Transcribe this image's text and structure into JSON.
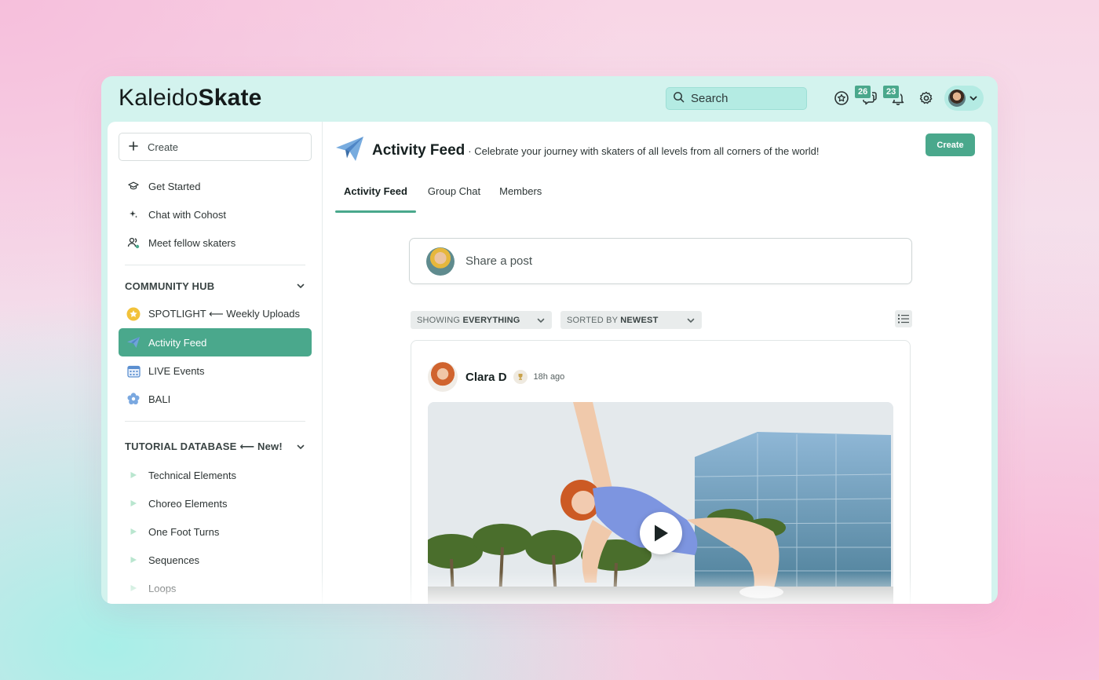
{
  "app": {
    "logo_light": "Kaleido",
    "logo_bold": "Skate"
  },
  "topbar": {
    "search_placeholder": "Search",
    "chat_badge": "26",
    "notifications_badge": "23"
  },
  "sidebar": {
    "create_label": "Create",
    "primary_items": [
      {
        "label": "Get Started",
        "icon": "graduation-cap-icon"
      },
      {
        "label": "Chat with Cohost",
        "icon": "sparkle-icon"
      },
      {
        "label": "Meet fellow skaters",
        "icon": "users-icon"
      }
    ],
    "community_hub": {
      "title": "COMMUNITY HUB",
      "items": [
        {
          "label": "SPOTLIGHT ⟵ Weekly Uploads",
          "icon": "star-icon"
        },
        {
          "label": "Activity Feed",
          "icon": "paper-plane-icon",
          "active": true
        },
        {
          "label": "LIVE Events",
          "icon": "calendar-icon"
        },
        {
          "label": "BALI",
          "icon": "flower-icon"
        }
      ]
    },
    "tutorial_database": {
      "title": "TUTORIAL DATABASE ⟵ New!",
      "items": [
        {
          "label": "Technical Elements",
          "icon": "play-triangle-icon"
        },
        {
          "label": "Choreo Elements",
          "icon": "play-triangle-icon"
        },
        {
          "label": "One Foot Turns",
          "icon": "play-triangle-icon"
        },
        {
          "label": "Sequences",
          "icon": "play-triangle-icon"
        },
        {
          "label": "Loops",
          "icon": "play-triangle-icon"
        }
      ]
    }
  },
  "main": {
    "title": "Activity Feed",
    "subtitle": "· Celebrate your journey with skaters of all levels from all corners of the world!",
    "create_label": "Create",
    "tabs": [
      {
        "label": "Activity Feed",
        "active": true
      },
      {
        "label": "Group Chat"
      },
      {
        "label": "Members"
      }
    ],
    "share_placeholder": "Share a post",
    "filter_showing_prefix": "SHOWING",
    "filter_showing_value": "EVERYTHING",
    "filter_sort_prefix": "SORTED BY",
    "filter_sort_value": "NEWEST",
    "post": {
      "author": "Clara D",
      "time": "18h ago"
    }
  },
  "colors": {
    "accent": "#4aa88c",
    "window_bg": "#d3f3ee",
    "search_bg": "#b4ebe3"
  }
}
